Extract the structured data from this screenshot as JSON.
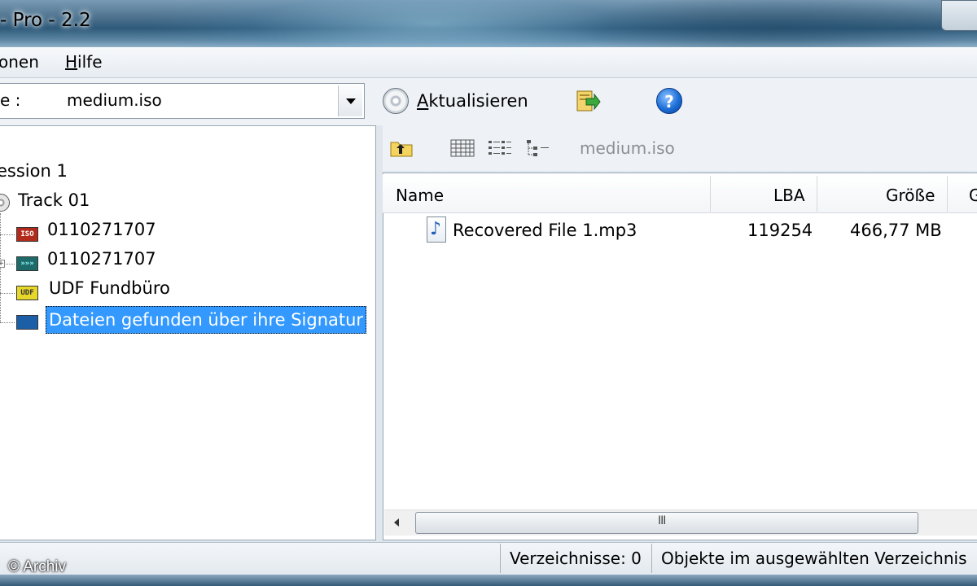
{
  "window": {
    "title": "- Pro - 2.2"
  },
  "menu": {
    "items": [
      {
        "pre": "",
        "acc": "",
        "post": "onen"
      },
      {
        "pre": "",
        "acc": "H",
        "post": "ilfe"
      }
    ]
  },
  "toolbar": {
    "drive_label": "e :",
    "drive_value": "medium.iso",
    "refresh_pre": "",
    "refresh_acc": "A",
    "refresh_post": "ktualisieren",
    "icons": [
      "disc-icon",
      "export-icon",
      "help-icon"
    ]
  },
  "tree": {
    "session": "ession 1",
    "track": "Track 01",
    "nodes": [
      {
        "badge": "ISO",
        "label": "0110271707",
        "color": "#b22a1c"
      },
      {
        "badge": "»»»",
        "label": "0110271707",
        "color": "#1d6a6a"
      },
      {
        "badge": "UDF",
        "label": "UDF Fundbüro",
        "color": "#d8c21a"
      },
      {
        "badge": "",
        "label": "Dateien gefunden über ihre Signatur",
        "color": "#1d5fa6",
        "selected": true
      }
    ]
  },
  "list": {
    "path": "medium.iso",
    "columns": [
      "Name",
      "LBA",
      "Größe",
      "G"
    ],
    "rows": [
      {
        "name": "Recovered File 1.mp3",
        "lba": "119254",
        "size": "466,77 MB"
      }
    ]
  },
  "scrollbar": {
    "grip": "III"
  },
  "status": {
    "dirs": "Verzeichnisse: 0",
    "objects": "Objekte im ausgewählten Verzeichnis"
  },
  "watermark": "© Archiv"
}
